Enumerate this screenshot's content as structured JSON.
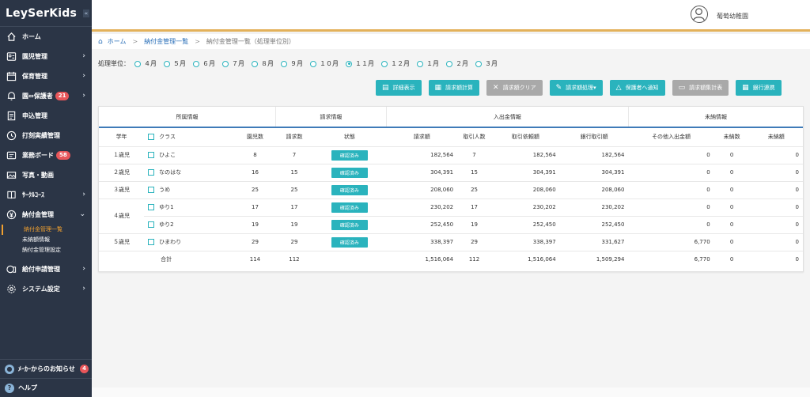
{
  "sidebar": {
    "logo": "LeySerKids",
    "collapse_icon": "«",
    "items": [
      {
        "label": "ホーム",
        "icon": "home-icon",
        "chevron": ""
      },
      {
        "label": "園児管理",
        "icon": "children-icon",
        "chevron": "›"
      },
      {
        "label": "保育管理",
        "icon": "calendar-icon",
        "chevron": "›"
      },
      {
        "label": "園⇔保護者",
        "icon": "bell-icon",
        "chevron": "›",
        "badge": "21"
      },
      {
        "label": "申込管理",
        "icon": "form-icon",
        "chevron": ""
      },
      {
        "label": "打刻実績管理",
        "icon": "clock-icon",
        "chevron": ""
      },
      {
        "label": "業務ボード",
        "icon": "board-icon",
        "chevron": "",
        "badge": "58"
      },
      {
        "label": "写真・動画",
        "icon": "photo-icon",
        "chevron": ""
      },
      {
        "label": "ｻｰｸﾙｺｰｽ",
        "icon": "book-icon",
        "chevron": "›"
      },
      {
        "label": "納付金管理",
        "icon": "yen-icon",
        "chevron": "⌄"
      }
    ],
    "sub_items": [
      "納付金管理一覧",
      "未納額情報",
      "納付金管理設定"
    ],
    "items_after": [
      {
        "label": "給付申請管理",
        "icon": "grant-icon",
        "chevron": "›"
      },
      {
        "label": "システム設定",
        "icon": "gear-icon",
        "chevron": "›"
      }
    ],
    "notice": {
      "label": "ﾒｰｶｰからのお知らせ",
      "badge": "4"
    },
    "help": {
      "label": "ヘルプ"
    }
  },
  "header": {
    "user_name": "葡萄幼稚園"
  },
  "breadcrumb": {
    "home": "ホーム",
    "level1": "納付金管理一覧",
    "current": "納付金管理一覧（処理単位別）"
  },
  "period": {
    "label": "処理単位：",
    "options": [
      "４月",
      "５月",
      "６月",
      "７月",
      "８月",
      "９月",
      "１０月",
      "１１月",
      "１２月",
      "１月",
      "２月",
      "３月"
    ],
    "selected": "１１月"
  },
  "toolbar": [
    {
      "label": "詳細表示",
      "icon": "doc-icon",
      "style": "teal"
    },
    {
      "label": "請求額計算",
      "icon": "calculator-icon",
      "style": "teal"
    },
    {
      "label": "請求額クリア",
      "icon": "x-icon",
      "style": "gray"
    },
    {
      "label": "請求額処理▾",
      "icon": "pencil-icon",
      "style": "teal"
    },
    {
      "label": "保護者へ通知",
      "icon": "bell-icon",
      "style": "teal"
    },
    {
      "label": "請求額集計表",
      "icon": "printer-icon",
      "style": "gray"
    },
    {
      "label": "銀行連携",
      "icon": "calculator-icon",
      "style": "teal"
    }
  ],
  "table": {
    "groups": {
      "affiliation": "所属情報",
      "billing": "請求情報",
      "payment": "入出金情報",
      "unpaid": "未納情報"
    },
    "columns": {
      "grade": "学年",
      "class": "クラス",
      "children": "園児数",
      "bill_count": "請求数",
      "status": "状態",
      "bill_amount": "請求額",
      "txn_count": "取引人数",
      "txn_request": "取引依頼額",
      "bank_amount": "銀行取引額",
      "other_amount": "その他入出金額",
      "unpaid_count": "未納数",
      "unpaid_amount": "未納額"
    },
    "rows": [
      {
        "grade": "１歳児",
        "class": "ひよこ",
        "children": "8",
        "bill_count": "7",
        "status": "確認済み",
        "bill_amount": "182,564",
        "txn_count": "7",
        "txn_request": "182,564",
        "bank_amount": "182,564",
        "other_amount": "0",
        "unpaid_count": "0",
        "unpaid_amount": "0"
      },
      {
        "grade": "２歳児",
        "class": "なのはな",
        "children": "16",
        "bill_count": "15",
        "status": "確認済み",
        "bill_amount": "304,391",
        "txn_count": "15",
        "txn_request": "304,391",
        "bank_amount": "304,391",
        "other_amount": "0",
        "unpaid_count": "0",
        "unpaid_amount": "0"
      },
      {
        "grade": "３歳児",
        "class": "うめ",
        "children": "25",
        "bill_count": "25",
        "status": "確認済み",
        "bill_amount": "208,060",
        "txn_count": "25",
        "txn_request": "208,060",
        "bank_amount": "208,060",
        "other_amount": "0",
        "unpaid_count": "0",
        "unpaid_amount": "0"
      },
      {
        "grade": "４歳児",
        "class": "ゆり1",
        "children": "17",
        "bill_count": "17",
        "status": "確認済み",
        "bill_amount": "230,202",
        "txn_count": "17",
        "txn_request": "230,202",
        "bank_amount": "230,202",
        "other_amount": "0",
        "unpaid_count": "0",
        "unpaid_amount": "0"
      },
      {
        "grade": "",
        "class": "ゆり2",
        "children": "19",
        "bill_count": "19",
        "status": "確認済み",
        "bill_amount": "252,450",
        "txn_count": "19",
        "txn_request": "252,450",
        "bank_amount": "252,450",
        "other_amount": "0",
        "unpaid_count": "0",
        "unpaid_amount": "0"
      },
      {
        "grade": "５歳児",
        "class": "ひまわり",
        "children": "29",
        "bill_count": "29",
        "status": "確認済み",
        "bill_amount": "338,397",
        "txn_count": "29",
        "txn_request": "338,397",
        "bank_amount": "331,627",
        "other_amount": "6,770",
        "unpaid_count": "0",
        "unpaid_amount": "0"
      }
    ],
    "total": {
      "label": "合計",
      "children": "114",
      "bill_count": "112",
      "bill_amount": "1,516,064",
      "txn_count": "112",
      "txn_request": "1,516,064",
      "bank_amount": "1,509,294",
      "other_amount": "6,770",
      "unpaid_count": "0",
      "unpaid_amount": "0"
    }
  },
  "colors": {
    "sidebar_bg": "#2b3546",
    "accent_teal": "#2ab3bd",
    "header_border": "#e3b15a",
    "badge_red": "#e8565a",
    "active_sub": "#f0a030",
    "link_blue": "#2a6fb8"
  }
}
